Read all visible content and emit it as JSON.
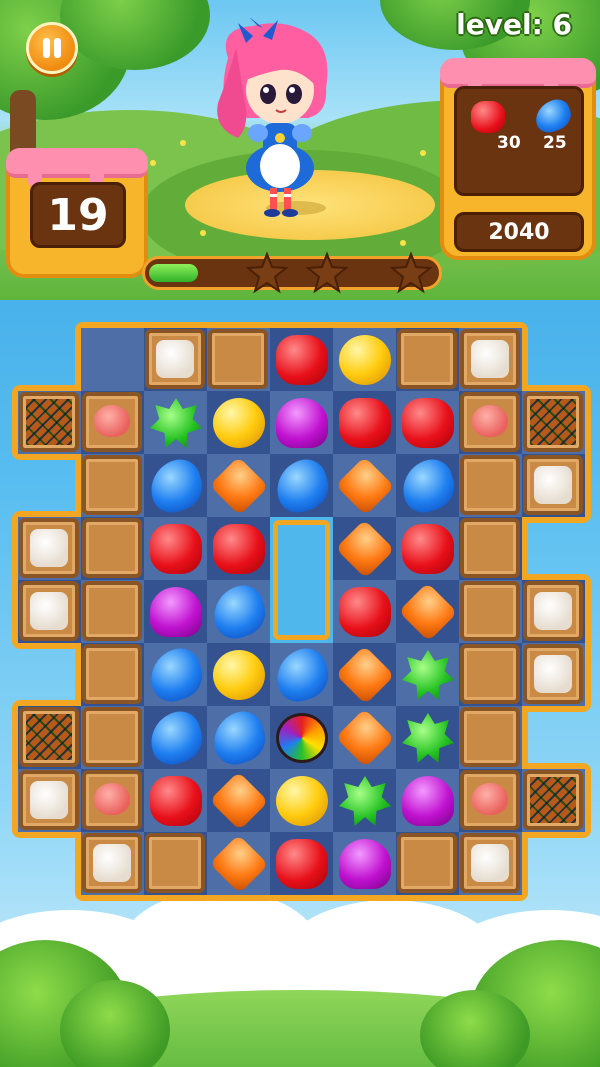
{
  "hud": {
    "level_label": "level: 6",
    "moves_left": "19",
    "score": "2040",
    "progress_fraction": 0.17,
    "stars_earned": 0,
    "stars_total": 3
  },
  "goals": [
    {
      "candy": "red",
      "icon": "red-candy-icon",
      "count": "30"
    },
    {
      "candy": "blue",
      "icon": "blue-candy-icon",
      "count": "25"
    }
  ],
  "colors": {
    "panel": "#f6b52a",
    "frosting": "#ff8fae",
    "board_dark": "#34528f",
    "board_light": "#4d6ea7"
  },
  "board": {
    "rows": [
      [
        ".",
        "X",
        "CC",
        "W",
        "R",
        "Y",
        "W",
        "CC",
        "."
      ],
      [
        "P",
        "CP",
        "G",
        "Y",
        "U",
        "R",
        "R",
        "CP",
        "P"
      ],
      [
        ".",
        "W",
        "B",
        "O",
        "B",
        "O",
        "B",
        "W",
        "CC"
      ],
      [
        "CC",
        "W",
        "R",
        "R",
        "H",
        "O",
        "R",
        "W",
        "."
      ],
      [
        "CC",
        "W",
        "U",
        "B",
        "H",
        "R",
        "O",
        "W",
        "CC"
      ],
      [
        ".",
        "W",
        "B",
        "Y",
        "B",
        "O",
        "G",
        "W",
        "CC"
      ],
      [
        "P",
        "W",
        "B",
        "B",
        "S",
        "O",
        "G",
        "W",
        "."
      ],
      [
        "CC",
        "CP",
        "R",
        "O",
        "Y",
        "G",
        "U",
        "CP",
        "P"
      ],
      [
        ".",
        "CC",
        "W",
        "O",
        "R",
        "U",
        "W",
        "CC",
        "."
      ]
    ],
    "legend": {
      "R": "red",
      "B": "blue",
      "U": "purple",
      "Y": "yellow",
      "O": "orange",
      "G": "green",
      "S": "swirl",
      "W": "wooden-crate",
      "CC": "cream-crate",
      "CP": "pink-crate",
      "P": "pie-crate",
      "H": "hole",
      ".": "empty"
    }
  }
}
